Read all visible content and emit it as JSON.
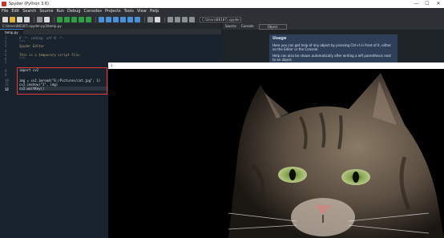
{
  "window": {
    "title": "Spyder (Python 3.6)",
    "minimize": "—",
    "maximize": "☐",
    "close": "✕"
  },
  "menu": [
    "File",
    "Edit",
    "Search",
    "Source",
    "Run",
    "Debug",
    "Consoles",
    "Projects",
    "Tools",
    "View",
    "Help"
  ],
  "toolbar": {
    "path": "C:\\Users\\86187\\.spyder-py3"
  },
  "editor": {
    "path": "C:\\Users\\86187\\.spyder-py3\\temp.py",
    "tab": "temp.py",
    "lines": [
      "# -*- coding: utf-8 -*-",
      "\"\"\"",
      "Spyder Editor",
      "",
      "This is a temporary script file.",
      "\"\"\"",
      "",
      "import cv2",
      "",
      "img = cv2.imread(\"E:/Pictures/cat.jpg\", 1)",
      "cv2.imshow(\"1\", img)",
      "cv2.waitKey()"
    ],
    "line_numbers": [
      "1",
      "2",
      "3",
      "4",
      "5",
      "6",
      "7",
      "8",
      "9",
      "10",
      "11",
      "12"
    ]
  },
  "help": {
    "tab_source": "Source",
    "tab_console": "Console",
    "tab_object": "Object",
    "usage_title": "Usage",
    "usage_text": "Here you can get help of any object by pressing Ctrl+I in front of it, either on the Editor or the Console.",
    "usage_text2": "Help can also be shown automatically after writing a left parenthesis next to an object."
  },
  "image_window": {
    "title": "1"
  }
}
